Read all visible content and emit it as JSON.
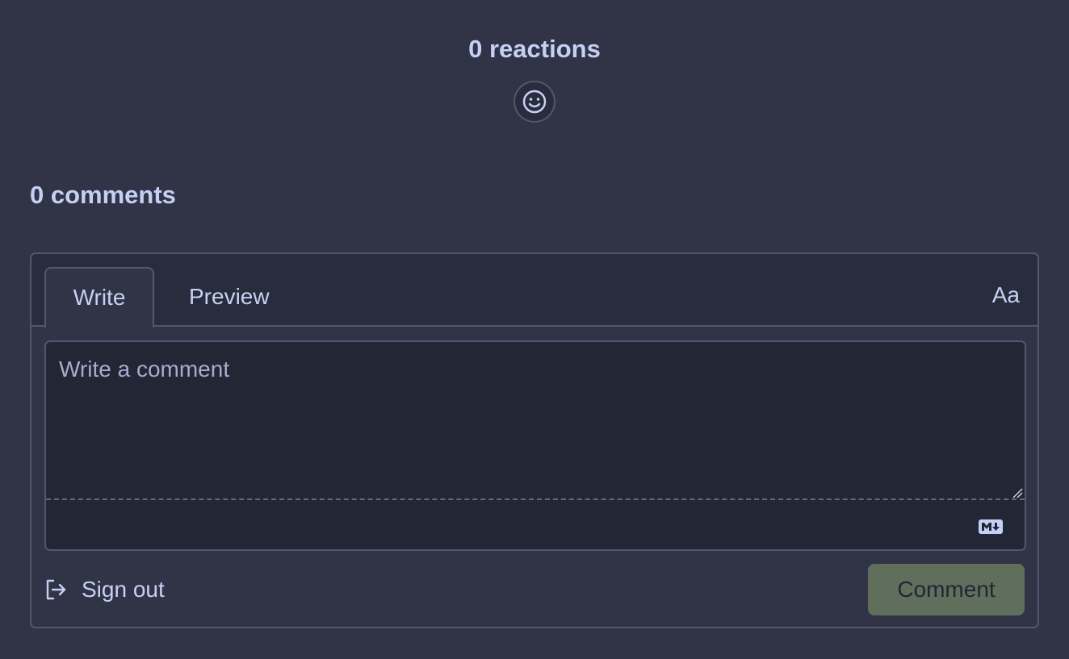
{
  "reactions": {
    "count_label": "0 reactions",
    "button_icon": "smiley-icon"
  },
  "comments": {
    "count_label": "0 comments"
  },
  "editor": {
    "tabs": [
      {
        "label": "Write",
        "active": true
      },
      {
        "label": "Preview",
        "active": false
      }
    ],
    "font_toggle_label": "Aa",
    "placeholder": "Write a comment",
    "value": "",
    "markdown_icon": "markdown-icon"
  },
  "footer": {
    "sign_out_label": "Sign out",
    "sign_out_icon": "sign-out-icon",
    "comment_button_label": "Comment",
    "comment_button_disabled": true
  },
  "colors": {
    "background": "#303446",
    "text": "#c6d0f5",
    "border": "#51576d",
    "editor_background": "#232634",
    "comment_button": "#5f6f5c"
  }
}
